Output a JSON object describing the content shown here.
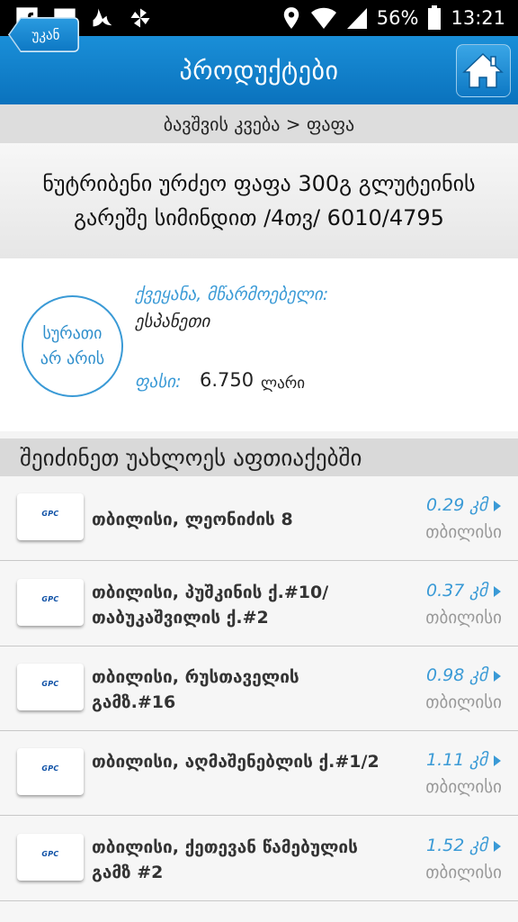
{
  "status_bar": {
    "battery": "56%",
    "time": "13:21",
    "icons": [
      "facebook-icon",
      "image-icon",
      "bird-icon",
      "pinwheel-icon",
      "location-icon",
      "wifi-icon",
      "signal-icon",
      "battery-icon"
    ]
  },
  "app_bar": {
    "back_label": "უკან",
    "title": "პროდუქტები",
    "home_icon": "home-icon"
  },
  "breadcrumb": "ბავშვის კვება > ფაფა",
  "product": {
    "name": "ნუტრიბენი ურძეო ფაფა 300გ გლუტეინის გარეშე სიმინდით /4თვ/ 6010/4795",
    "no_image_line1": "სურათი",
    "no_image_line2": "არ არის",
    "country_label": "ქვეყანა, მწარმოებელი:",
    "country_value": "ესპანეთი",
    "price_label": "ფასი:",
    "price_value": "6.750",
    "currency": "ლარი"
  },
  "section_title": "შეიძინეთ უახლოეს აფთიაქებში",
  "pharmacies": [
    {
      "logo": "GPC",
      "address": "თბილისი, ლეონიძის 8",
      "distance": "0.29 კმ",
      "city": "თბილისი"
    },
    {
      "logo": "GPC",
      "address": "თბილისი, პუშკინის ქ.#10/ თაბუკაშვილის ქ.#2",
      "distance": "0.37 კმ",
      "city": "თბილისი"
    },
    {
      "logo": "GPC",
      "address": "თბილისი, რუსთაველის გამზ.#16",
      "distance": "0.98 კმ",
      "city": "თბილისი"
    },
    {
      "logo": "GPC",
      "address": "თბილისი, აღმაშენებლის ქ.#1/2",
      "distance": "1.11 კმ",
      "city": "თბილისი"
    },
    {
      "logo": "GPC",
      "address": "თბილისი, ქეთევან წამებულის გამზ #2",
      "distance": "1.52 კმ",
      "city": "თბილისი"
    }
  ],
  "colors": {
    "accent": "#1a8fd8",
    "link_blue": "#3a9ad6",
    "logo_blue": "#0c4fa5"
  }
}
